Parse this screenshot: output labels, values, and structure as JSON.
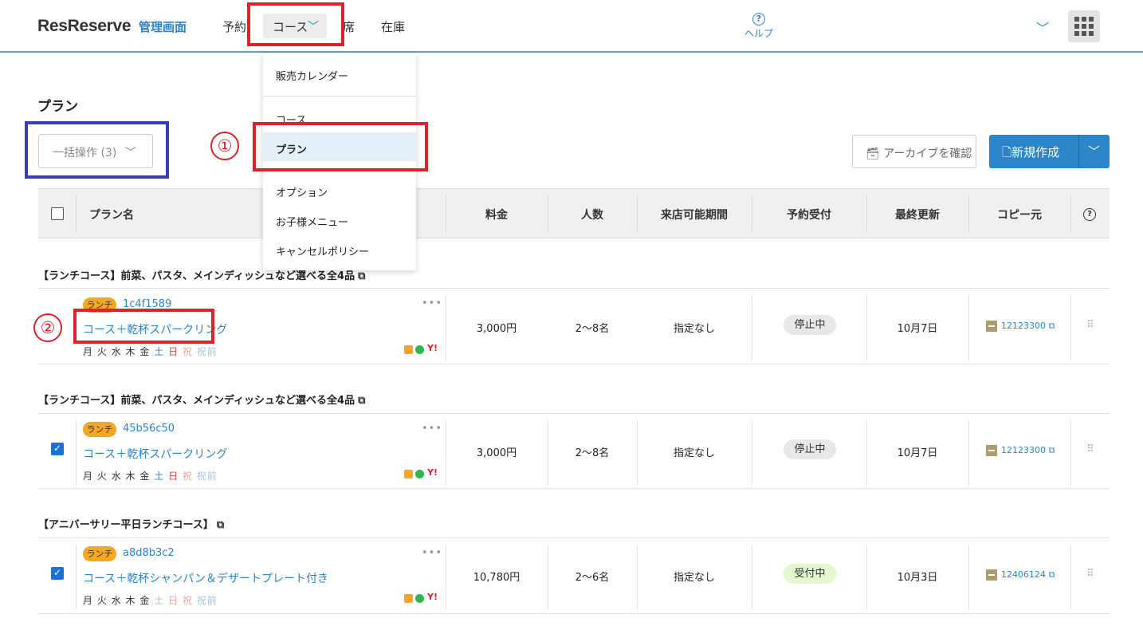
{
  "header": {
    "logo": "ResReserve",
    "logo_sub": "管理画面",
    "nav": {
      "reservations": "予約",
      "course": "コース",
      "seats": "席",
      "inventory": "在庫"
    },
    "help": "ヘルプ"
  },
  "dropdown": {
    "items": [
      "販売カレンダー",
      "コース",
      "プラン",
      "オプション",
      "お子様メニュー",
      "キャンセルポリシー"
    ],
    "active": "プラン"
  },
  "annotations": {
    "step1": "①",
    "step2": "②"
  },
  "page": {
    "title": "プラン",
    "bulk_action": "一括操作 (3)",
    "archive_button": "アーカイブを確認",
    "new_button": "新規作成"
  },
  "table": {
    "headers": [
      "プラン名",
      "料金",
      "人数",
      "来店可能期間",
      "予約受付",
      "最終更新",
      "コピー元"
    ],
    "groups": [
      {
        "title": "【ランチコース】前菜、パスタ、メインディッシュなど選べる全4品",
        "row": {
          "badge": "ランチ",
          "code": "1c4f1589",
          "name": "コース＋乾杯スパークリング",
          "checked": false,
          "price": "3,000円",
          "people": "2〜8名",
          "period": "指定なし",
          "status": "停止中",
          "updated": "10月7日",
          "copy": "12123300"
        }
      },
      {
        "title": "【ランチコース】前菜、パスタ、メインディッシュなど選べる全4品",
        "row": {
          "badge": "ランチ",
          "code": "45b56c50",
          "name": "コース＋乾杯スパークリング",
          "checked": true,
          "price": "3,000円",
          "people": "2〜8名",
          "period": "指定なし",
          "status": "停止中",
          "updated": "10月7日",
          "copy": "12123300"
        }
      },
      {
        "title": "【アニバーサリー平日ランチコース】",
        "row": {
          "badge": "ランチ",
          "code": "a8d8b3c2",
          "name": "コース＋乾杯シャンパン＆デザートプレート付き",
          "checked": true,
          "price": "10,780円",
          "people": "2〜6名",
          "period": "指定なし",
          "status": "受付中",
          "updated": "10月3日",
          "copy": "12406124"
        }
      }
    ],
    "days": [
      "月",
      "火",
      "水",
      "木",
      "金",
      "土",
      "日",
      "祝",
      "祝前"
    ]
  },
  "icons": [
    "chevron-down-icon",
    "help-icon",
    "apps-grid-icon",
    "archive-icon",
    "document-icon",
    "external-link-icon",
    "more-icon",
    "drag-handle-icon"
  ],
  "colors": {
    "accent": "#2b85c8",
    "annotation_red": "#e0202a",
    "annotation_blue": "#3a3ac0",
    "badge_lunch": "#f5a623"
  }
}
